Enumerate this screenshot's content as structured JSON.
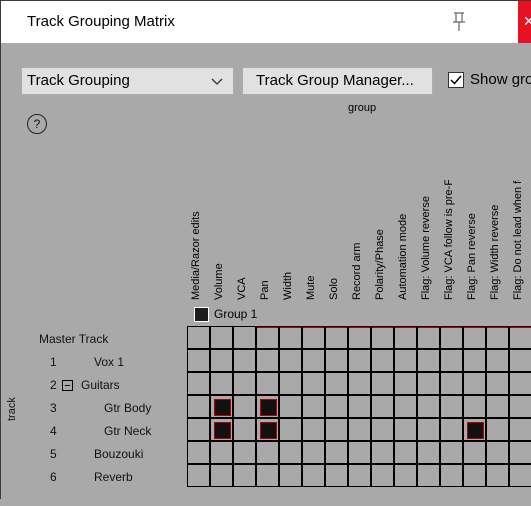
{
  "window": {
    "title": "Track Grouping Matrix"
  },
  "toolbar": {
    "mode_value": "Track Grouping",
    "manager_label": "Track Group Manager...",
    "show_label": "Show gro",
    "help_label": "?"
  },
  "matrix": {
    "axis_label": "group",
    "track_axis_label": "track",
    "columns": [
      "Media/Razor edits",
      "Volume",
      "VCA",
      "Pan",
      "Width",
      "Mute",
      "Solo",
      "Record arm",
      "Polarity/Phase",
      "Automation mode",
      "Flag: Volume reverse",
      "Flag: VCA follow is pre-FX",
      "Flag: Pan reverse",
      "Flag: Width reverse",
      "Flag: Do not lead when follo"
    ],
    "group": {
      "name": "Group 1"
    },
    "tracks": [
      {
        "num": "",
        "name": "Master Track",
        "marks": []
      },
      {
        "num": "1",
        "name": "Vox 1",
        "marks": []
      },
      {
        "num": "2",
        "name": "Guitars",
        "marks": []
      },
      {
        "num": "3",
        "name": "Gtr Body",
        "marks": [
          1,
          3
        ]
      },
      {
        "num": "4",
        "name": "Gtr Neck",
        "marks": [
          1,
          3,
          12
        ]
      },
      {
        "num": "5",
        "name": "Bouzouki",
        "marks": []
      },
      {
        "num": "6",
        "name": "Reverb",
        "marks": []
      }
    ]
  }
}
